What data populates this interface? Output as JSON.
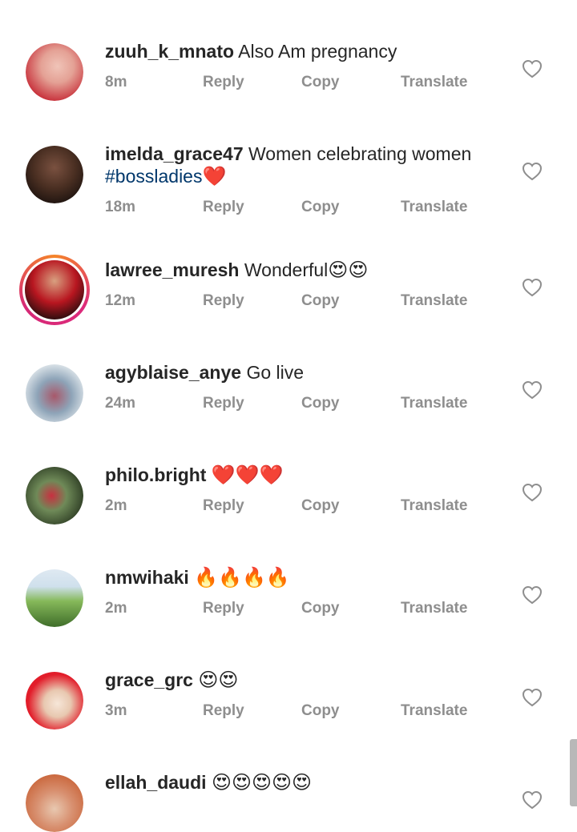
{
  "action_labels": {
    "reply": "Reply",
    "copy": "Copy",
    "translate": "Translate"
  },
  "comments": [
    {
      "username": "zuuh_k_mnato",
      "text": "Also Am pregnancy",
      "hashtag": "",
      "emoji": "",
      "time": "8m",
      "avatar_colors": [
        "#e9b0a4",
        "#c8323c"
      ]
    },
    {
      "username": "imelda_grace47",
      "text": "Women celebrating women",
      "hashtag": "#bossladies",
      "emoji": "❤️",
      "time": "18m",
      "avatar_colors": [
        "#5a3b2c",
        "#2a1a14"
      ]
    },
    {
      "username": "lawree_muresh",
      "text": "Wonderful",
      "hashtag": "",
      "emoji": "😍😍",
      "time": "12m",
      "avatar_colors": [
        "#c0121e",
        "#1a0c0c"
      ]
    },
    {
      "username": "agyblaise_anye",
      "text": "Go live",
      "hashtag": "",
      "emoji": "",
      "time": "24m",
      "avatar_colors": [
        "#dfe6ea",
        "#7c94a8"
      ]
    },
    {
      "username": "philo.bright",
      "text": "",
      "hashtag": "",
      "emoji": "❤️❤️❤️",
      "time": "2m",
      "avatar_colors": [
        "#5f7a4a",
        "#2b3a22"
      ]
    },
    {
      "username": "nmwihaki",
      "text": "",
      "hashtag": "",
      "emoji": "🔥🔥🔥🔥",
      "time": "2m",
      "avatar_colors": [
        "#9ccb6a",
        "#3f6d2a"
      ]
    },
    {
      "username": "grace_grc",
      "text": "",
      "hashtag": "",
      "emoji": "😍😍",
      "time": "3m",
      "avatar_colors": [
        "#e21d2a",
        "#f4e2d4"
      ]
    },
    {
      "username": "ellah_daudi",
      "text": "",
      "hashtag": "",
      "emoji": "😍😍😍😍😍",
      "time": "",
      "avatar_colors": [
        "#c9653a",
        "#e8c8b0"
      ]
    }
  ],
  "icons": {
    "like": "heart-outline-icon"
  }
}
